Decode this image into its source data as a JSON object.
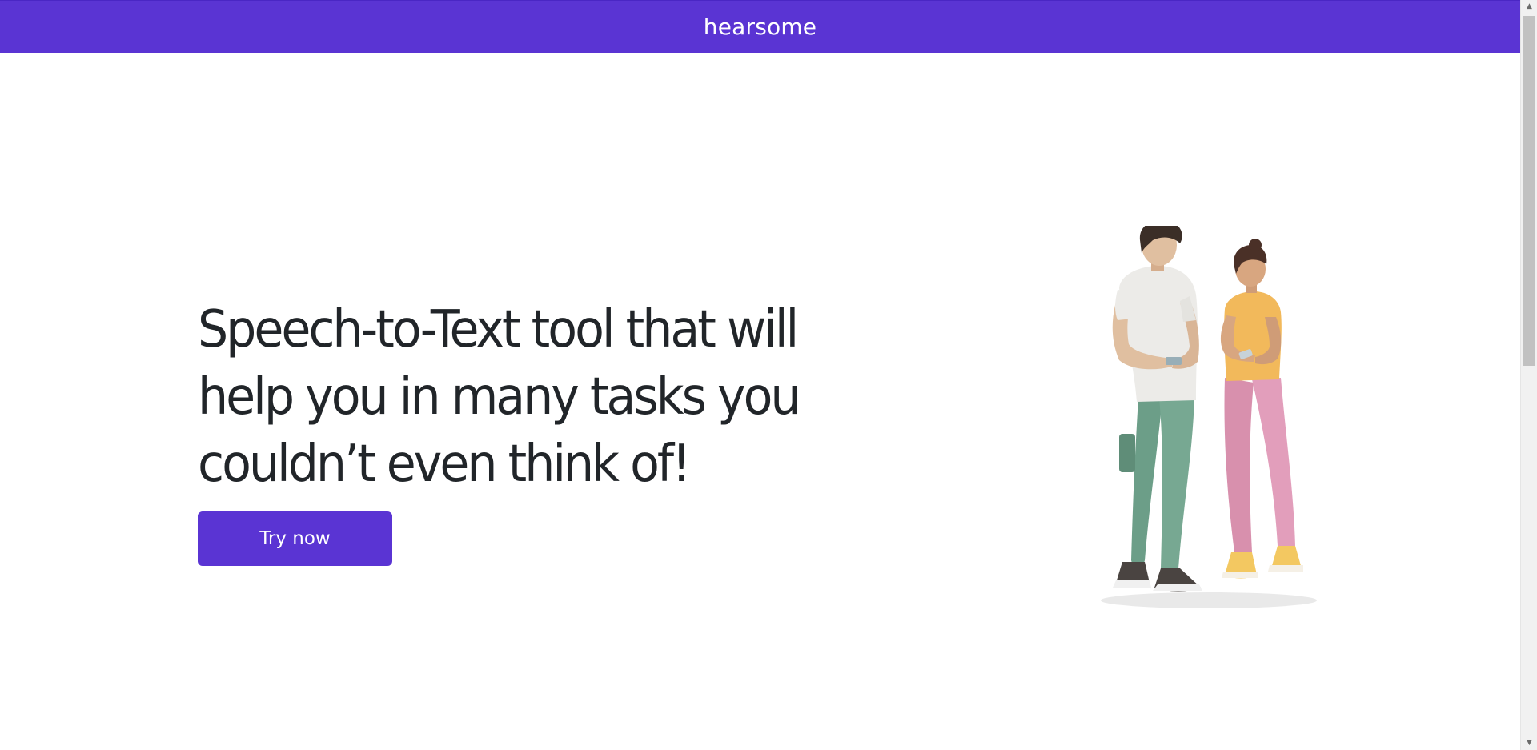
{
  "header": {
    "brand": "hearsome",
    "background_color": "#5a34d3"
  },
  "hero": {
    "headline": "Speech-to-Text tool that will help you in many tasks you couldn’t even think of!",
    "cta_label": "Try now"
  },
  "illustration": {
    "icon": "people-looking-at-phones-illustration"
  },
  "scrollbar": {
    "up_icon": "▲",
    "down_icon": "▼"
  }
}
